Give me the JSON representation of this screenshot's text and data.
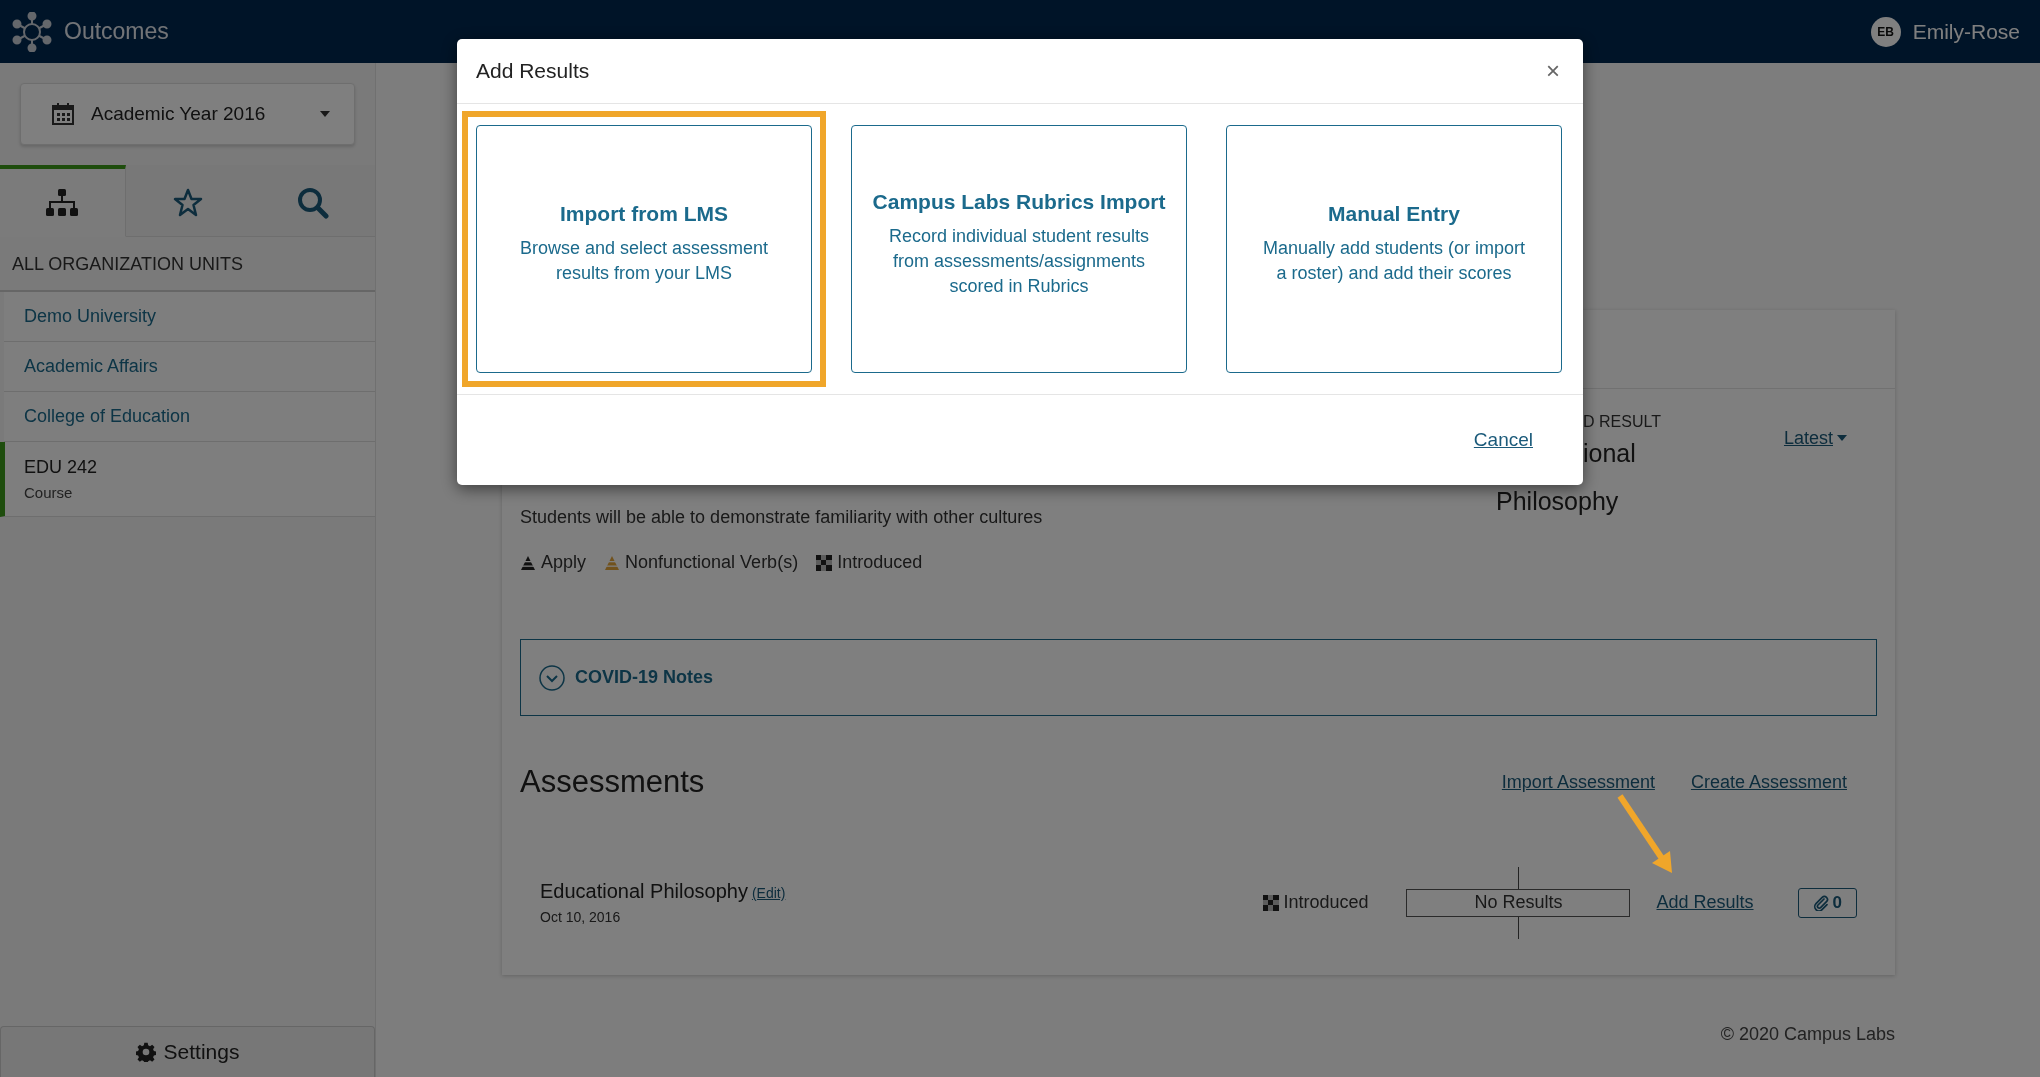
{
  "header": {
    "app_name": "Outcomes",
    "user": {
      "initials": "EB",
      "name": "Emily-Rose"
    }
  },
  "sidebar": {
    "year_selector": "Academic Year 2016",
    "tabs": [
      {
        "kind": "hierarchy",
        "selected": true
      },
      {
        "kind": "star",
        "selected": false
      },
      {
        "kind": "search",
        "selected": false
      }
    ],
    "section_label": "ALL ORGANIZATION UNITS",
    "items": [
      {
        "label": "Demo University",
        "selected": false
      },
      {
        "label": "Academic Affairs",
        "selected": false
      },
      {
        "label": "College of Education",
        "selected": false
      },
      {
        "label": "EDU 242",
        "sublabel": "Course",
        "selected": true
      }
    ],
    "settings": "Settings"
  },
  "outcome": {
    "result_label": "D RESULT",
    "result_lines": [
      "ional",
      "Philosophy"
    ],
    "latest_dropdown": "Latest",
    "description": "Students will be able to demonstrate familiarity with other cultures",
    "tags": [
      {
        "kind": "bloom",
        "label": "Apply"
      },
      {
        "kind": "warning",
        "label": "Nonfunctional Verb(s)"
      },
      {
        "kind": "level",
        "label": "Introduced"
      }
    ],
    "notes": {
      "label": "COVID-19 Notes",
      "expanded": false
    }
  },
  "assessments": {
    "title": "Assessments",
    "actions": [
      "Import Assessment",
      "Create Assessment"
    ],
    "rows": [
      {
        "name": "Educational Philosophy",
        "edit": "(Edit)",
        "date": "Oct 10, 2016",
        "level": "Introduced",
        "results": "No Results",
        "add": "Add Results",
        "attachments": "0"
      }
    ]
  },
  "footer": "© 2020 Campus Labs",
  "modal": {
    "title": "Add Results",
    "close": "×",
    "options": [
      {
        "title": "Import from LMS",
        "description": "Browse and select assessment results from your LMS",
        "highlighted": true
      },
      {
        "title": "Campus Labs Rubrics Import",
        "description": "Record individual student results from assessments/assignments scored in Rubrics",
        "highlighted": false
      },
      {
        "title": "Manual Entry",
        "description": "Manually add students (or import a roster) and add their scores",
        "highlighted": false
      }
    ],
    "cancel": "Cancel"
  }
}
